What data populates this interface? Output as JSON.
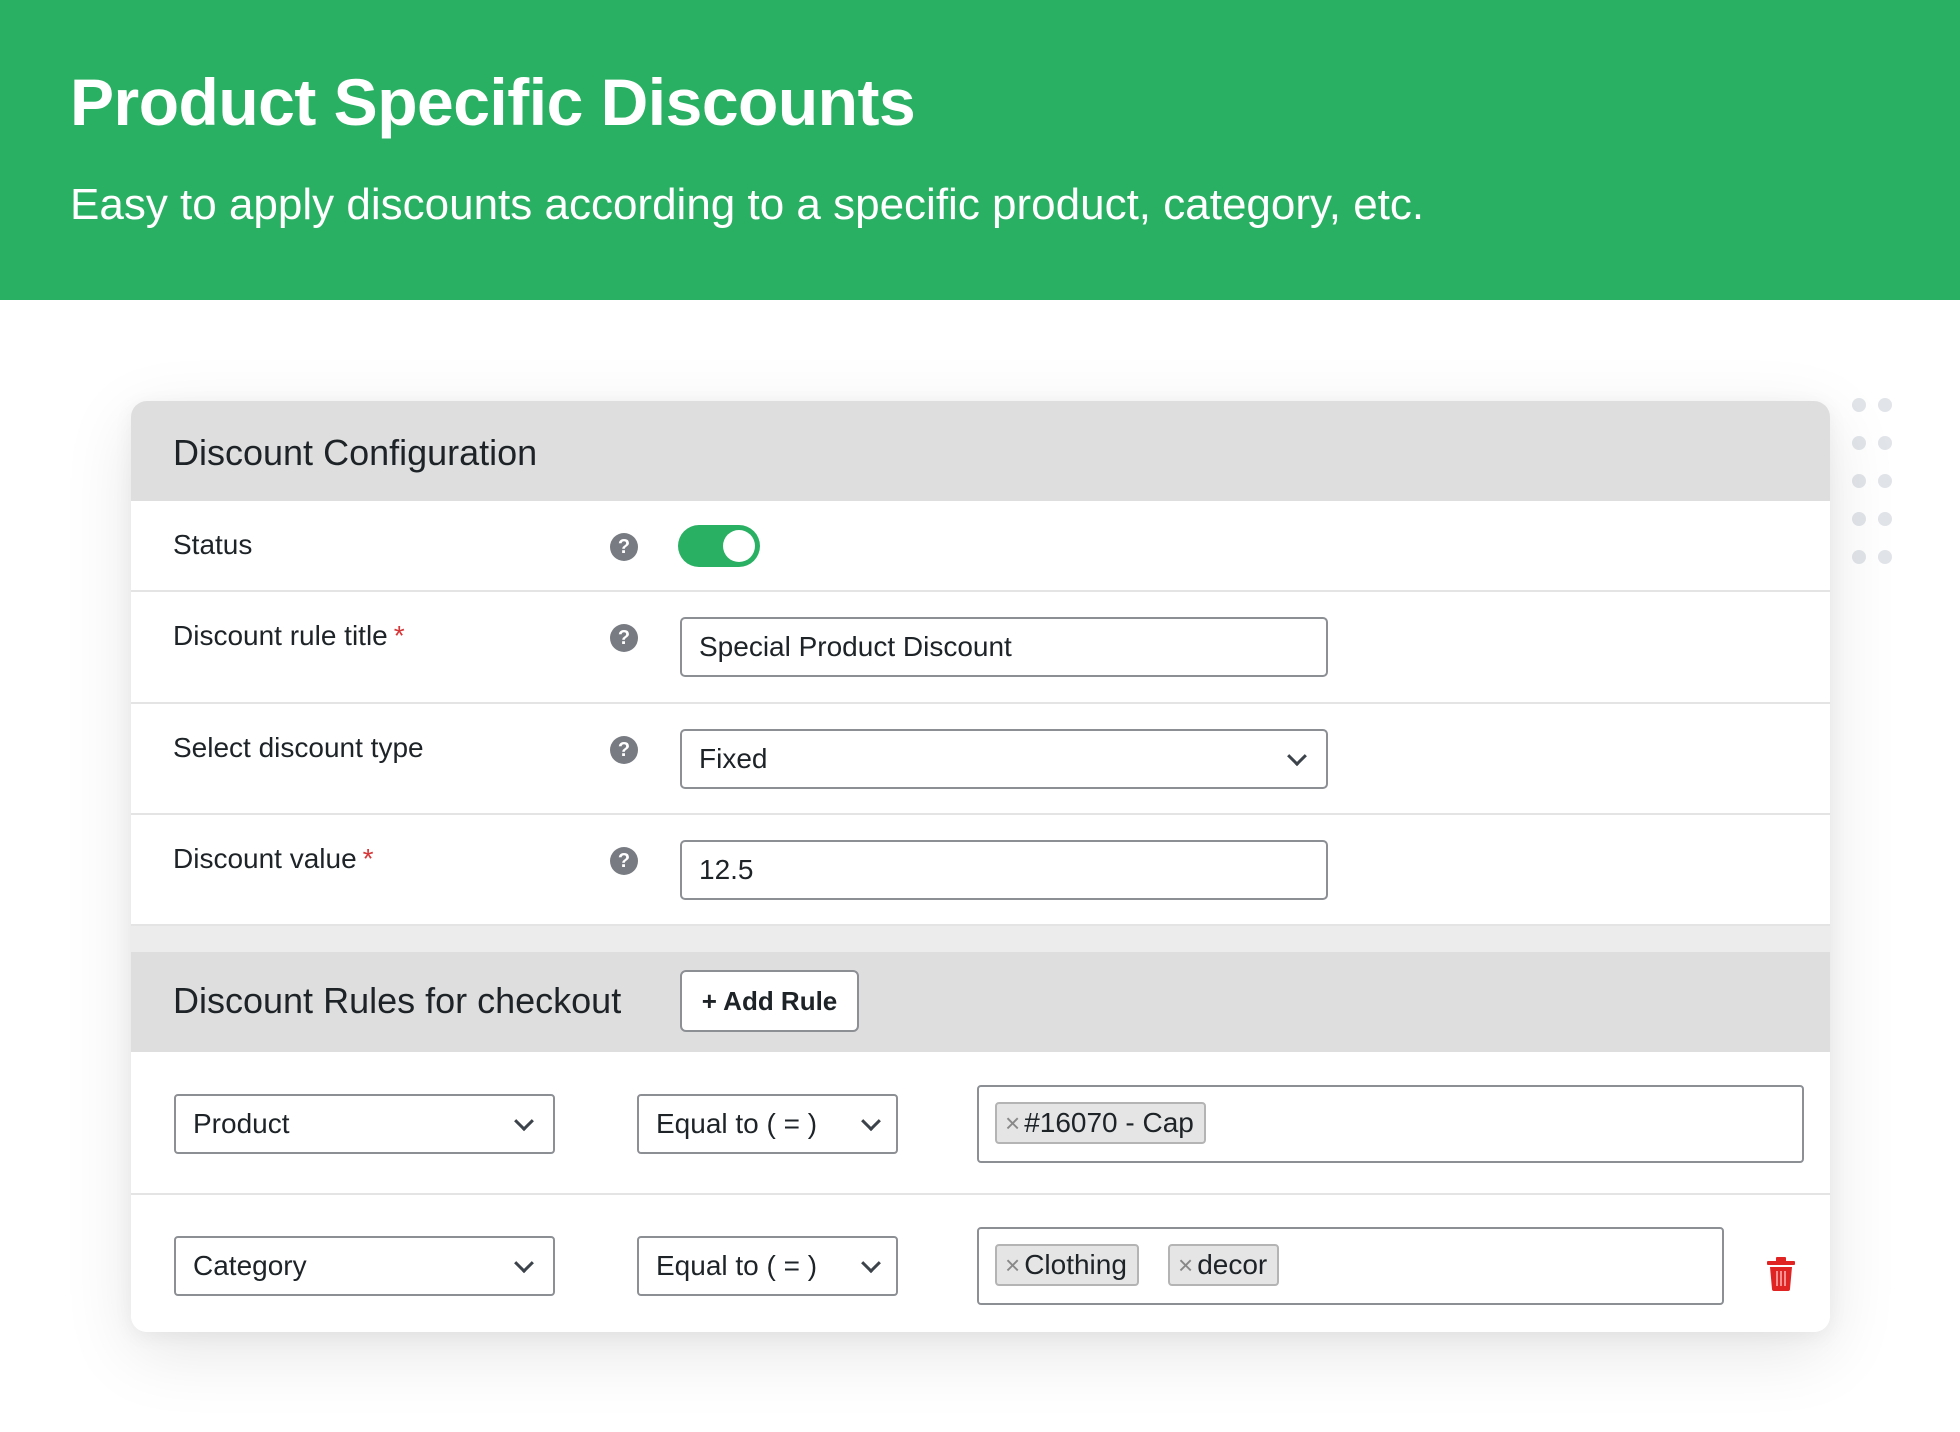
{
  "hero": {
    "title": "Product Specific Discounts",
    "subtitle": "Easy to apply discounts according to a specific product, category, etc."
  },
  "config": {
    "title": "Discount Configuration",
    "rows": {
      "status": {
        "label": "Status",
        "enabled": true
      },
      "rule_title": {
        "label": "Discount rule title",
        "required_mark": "*",
        "value": "Special Product Discount"
      },
      "discount_type": {
        "label": "Select discount type",
        "value": "Fixed"
      },
      "discount_value": {
        "label": "Discount value",
        "required_mark": "*",
        "value": "12.5"
      }
    },
    "help_icon": "?"
  },
  "rules": {
    "title": "Discount Rules for checkout",
    "add_button": "+ Add Rule",
    "items": [
      {
        "field": "Product",
        "operator": "Equal to ( = )",
        "tags": [
          "#16070 - Cap"
        ],
        "deletable": false
      },
      {
        "field": "Category",
        "operator": "Equal to ( = )",
        "tags": [
          "Clothing",
          "decor"
        ],
        "deletable": true
      }
    ],
    "tag_remove_glyph": "×"
  },
  "colors": {
    "brand_green": "#29b063",
    "required_red": "#d63638",
    "delete_red": "#e02424"
  }
}
